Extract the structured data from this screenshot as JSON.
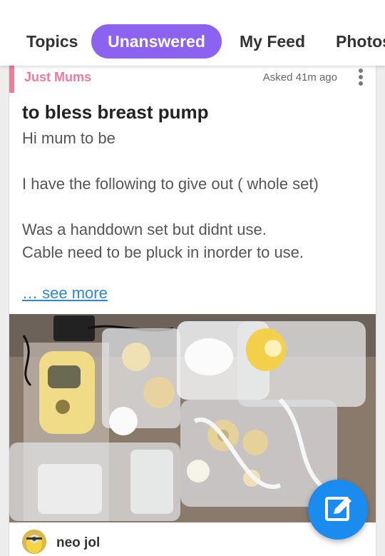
{
  "tabs": [
    {
      "label": "Topics",
      "active": false
    },
    {
      "label": "Unanswered",
      "active": true
    },
    {
      "label": "My Feed",
      "active": false
    },
    {
      "label": "Photos",
      "active": false
    }
  ],
  "post": {
    "group": "Just Mums",
    "asked": "Asked 41m ago",
    "title": "to bless breast pump",
    "body_lines": [
      "Hi mum to be",
      "",
      "I have the following to give out ( whole set)",
      "",
      "Was a handdown set but didnt use.",
      "Cable need to be pluck in inorder to use."
    ],
    "see_more": "… see more",
    "author": "neo jol"
  },
  "colors": {
    "accent_tab": "#8b63f0",
    "group_pink": "#f27a9c",
    "link_blue": "#2b86d8",
    "fab_blue": "#1a8cef"
  },
  "icons": {
    "menu": "more-vertical-icon",
    "fab": "compose-icon"
  }
}
